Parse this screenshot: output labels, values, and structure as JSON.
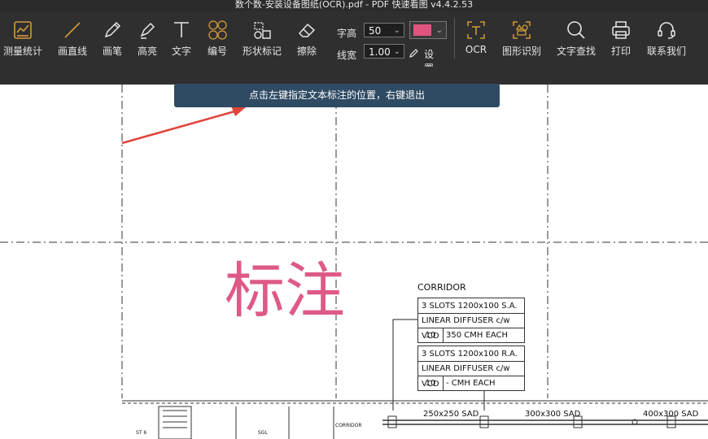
{
  "window": {
    "title": "数个数-安装设备图纸(OCR).pdf - PDF 快速看图 v4.4.2.53"
  },
  "toolbar": {
    "tools": [
      {
        "id": "measure",
        "label": "测量统计",
        "icon": "measure-stats-icon"
      },
      {
        "id": "line",
        "label": "画直线",
        "icon": "line-icon"
      },
      {
        "id": "pen",
        "label": "画笔",
        "icon": "pen-icon"
      },
      {
        "id": "highlight",
        "label": "高亮",
        "icon": "highlighter-icon"
      },
      {
        "id": "text",
        "label": "文字",
        "icon": "text-icon"
      },
      {
        "id": "number",
        "label": "编号",
        "icon": "numbering-icon"
      },
      {
        "id": "shape",
        "label": "形状标记",
        "icon": "shape-mark-icon"
      },
      {
        "id": "erase",
        "label": "擦除",
        "icon": "eraser-icon"
      },
      {
        "id": "ocr",
        "label": "OCR",
        "icon": "ocr-icon"
      },
      {
        "id": "shape_recog",
        "label": "图形识别",
        "icon": "shape-recognition-icon"
      },
      {
        "id": "text_search",
        "label": "文字查找",
        "icon": "search-icon"
      },
      {
        "id": "print",
        "label": "打印",
        "icon": "printer-icon"
      },
      {
        "id": "contact",
        "label": "联系我们",
        "icon": "headset-icon"
      }
    ],
    "font_size_label": "字高",
    "font_size_value": "50",
    "line_width_label": "线宽",
    "line_width_value": "1.00",
    "settings_label": "设置",
    "color_value": "#e0557f"
  },
  "hint": {
    "text": "点击左键指定文本标注的位置，右键退出"
  },
  "annotation": {
    "text": "标注",
    "color": "#de5a86"
  },
  "drawing": {
    "corridor_title": "CORRIDOR",
    "block1": [
      "3 SLOTS 1200x100 S.A.",
      "LINEAR DIFFUSER c/w VCD"
    ],
    "block1_qty": "10",
    "block1_flow": "350 CMH EACH",
    "block2": [
      "3 SLOTS 1200x100 R.A.",
      "LINEAR DIFFUSER c/w VCD"
    ],
    "block2_qty": "10",
    "block2_flow": "- CMH EACH",
    "duct1": "250x250 SAD",
    "duct2": "300x300 SAD",
    "duct3": "400x300 SAD",
    "room1": "ST 6",
    "room2": "SGL",
    "room3": "CORRIDOR"
  }
}
